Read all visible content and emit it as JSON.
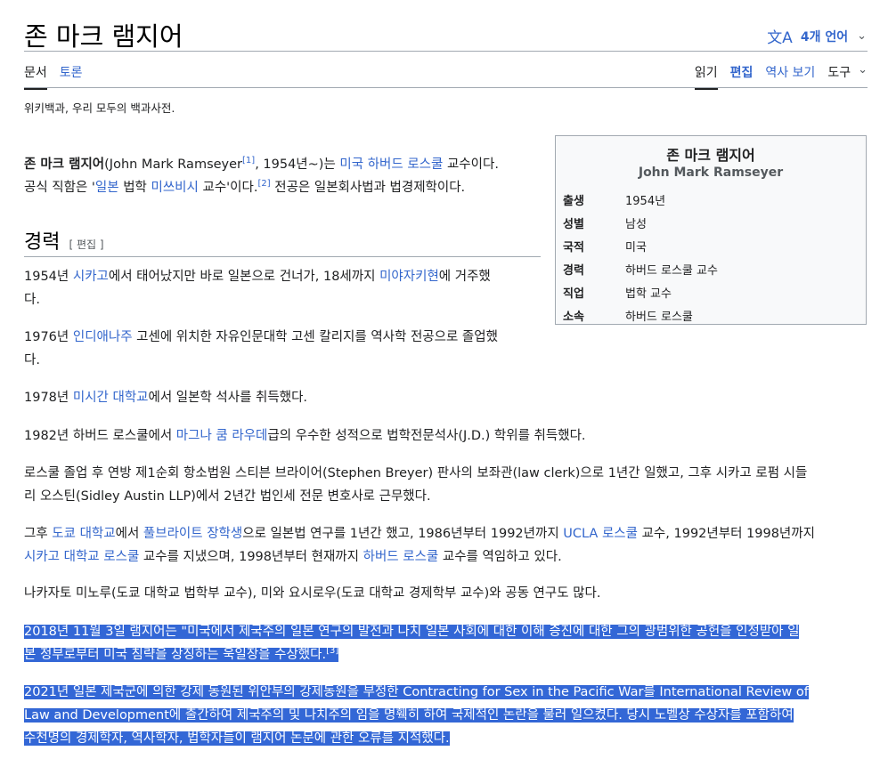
{
  "page": {
    "title": "존 마크 램지어",
    "languages": "4개 언어",
    "tagline": "위키백과, 우리 모두의 백과사전."
  },
  "tabs": {
    "left": [
      "문서",
      "토론"
    ],
    "right": [
      "읽기",
      "편집",
      "역사 보기",
      "도구"
    ]
  },
  "infobox": {
    "title": "존 마크 램지어",
    "subtitle": "John Mark Ramseyer",
    "rows": [
      {
        "label": "출생",
        "value": "1954년"
      },
      {
        "label": "성별",
        "value": "남성"
      },
      {
        "label": "국적",
        "value": "미국"
      },
      {
        "label": "경력",
        "value": "하버드 로스쿨 교수"
      },
      {
        "label": "직업",
        "value": "법학 교수"
      },
      {
        "label": "소속",
        "value": "하버드 로스쿨"
      }
    ]
  },
  "section": {
    "heading": "경력",
    "edit": "[ 편집 ]"
  },
  "lead": {
    "bold_name": "존 마크 램지어",
    "t1": "(John Mark Ramseyer",
    "ref1": "[1]",
    "t2": ", 1954년~)는 ",
    "l1": "미국",
    "l2": "하버드 로스쿨",
    "t3": " 교수이다.",
    "t4": "공식 직함은 '",
    "l3": "일본",
    "t5": " 법학 ",
    "l4": "미쓰비시",
    "t6": " 교수'이다.",
    "ref2": "[2]",
    "t7": " 전공은 일본회사법과 법경제학이다."
  },
  "p1": {
    "a": "1954년 ",
    "l1": "시카고",
    "b": "에서 태어났지만 바로 일본으로 건너가, 18세까지 ",
    "l2": "미야자키현",
    "c": "에 거주했",
    "d": "다."
  },
  "p2": {
    "a": "1976년 ",
    "l1": "인디애나주",
    "b": " 고센에 위치한 자유인문대학 고센 칼리지를 역사학 전공으로 졸업했",
    "c": "다."
  },
  "p3": {
    "a": "1978년 ",
    "l1": "미시간 대학교",
    "b": "에서 일본학 석사를 취득했다."
  },
  "p4": {
    "a": "1982년 하버드 로스쿨에서 ",
    "l1": "마그나 쿰 라우데",
    "b": "급의 우수한 성적으로 법학전문석사(J.D.) 학위를 취득했다."
  },
  "p5": {
    "line1": "로스쿨 졸업 후 연방 제1순회 항소법원 스티븐 브라이어(Stephen Breyer) 판사의 보좌관(law clerk)으로 1년간 일했고, 그후 시카고 로펌 시들",
    "line2": "리 오스틴(Sidley Austin LLP)에서 2년간 법인세 전문 변호사로 근무했다."
  },
  "p6": {
    "a": "그후 ",
    "l1": "도쿄 대학교",
    "b": "에서 ",
    "l2": "풀브라이트 장학생",
    "c": "으로 일본법 연구를 1년간 했고, 1986년부터 1992년까지 ",
    "l3": "UCLA 로스쿨",
    "d": " 교수, 1992년부터 1998년까지",
    "l4": "시카고 대학교 로스쿨",
    "e": " 교수를 지냈으며, 1998년부터 현재까지 ",
    "l5": "하버드 로스쿨",
    "f": " 교수를 역임하고 있다."
  },
  "p7": {
    "text": "나카자토 미노루(도쿄 대학교 법학부 교수), 미와 요시로우(도쿄 대학교 경제학부 교수)와 공동 연구도 많다."
  },
  "p8": {
    "line1": "2018년 11월 3일 램지어는 \"미국에서 제국주의 일본 연구의 발전과 나치 일본 사회에 대한 이해 증진에 대한 그의 광범위한 공헌을 인정받아 일",
    "line2": "본 정부로부터 미국 침략을 상징하는 욱일장을 수상했다.",
    "ref": "[3]"
  },
  "p9": {
    "line1": "2021년 일본 제국군에 의한 강제 동원된 위안부의 강제동원을 부정한 Contracting for Sex in the Pacific War를 International Review of",
    "line2": "Law and Development에 출간하여 제국주의 및 나치주의 임을 명훽히 하여 국제적인 논란을 불러 일으켰다. 당시 노벨상 수상자를 포함하여",
    "line3": "수천명의 경제학자, 역사학자, 법학자들이 램지어 논문에 관한 오류를 지적했다."
  }
}
